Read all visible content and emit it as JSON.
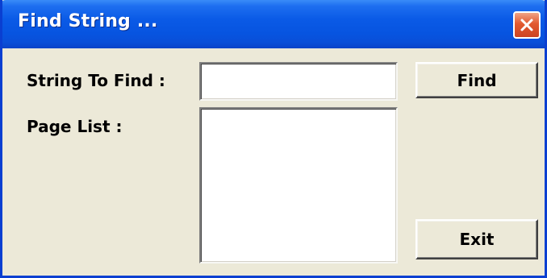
{
  "window": {
    "title": "Find String ..."
  },
  "form": {
    "string_label": "String To Find :",
    "string_value": "",
    "page_list_label": "Page List :",
    "page_list_items": []
  },
  "buttons": {
    "find_label": "Find",
    "exit_label": "Exit"
  },
  "icons": {
    "close": "close-icon"
  },
  "colors": {
    "titlebar": "#0a5ae6",
    "window_bg": "#ece9d8",
    "close_button": "#e2592f"
  }
}
